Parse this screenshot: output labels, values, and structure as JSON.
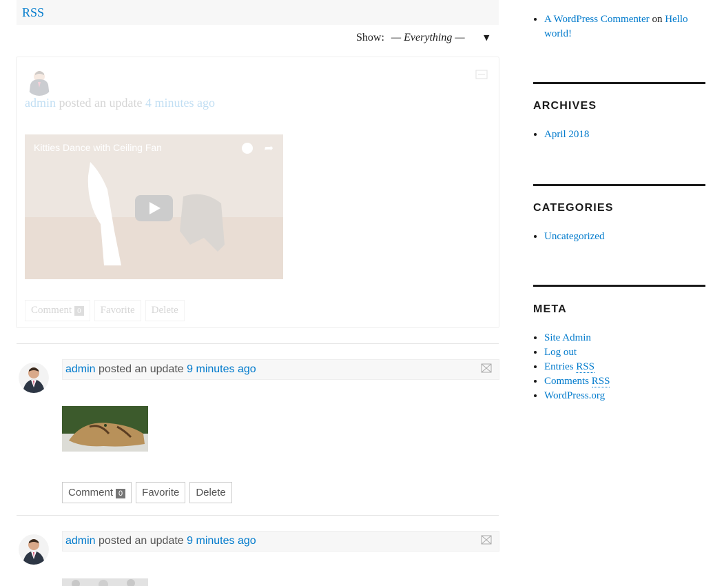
{
  "header": {
    "rss_label": "RSS"
  },
  "filter": {
    "show_label": "Show:",
    "selected": "— Everything —",
    "arrow": "▼"
  },
  "faded_update": {
    "user": "admin",
    "action": "posted an update",
    "time": "4 minutes ago",
    "video_title": "Kitties Dance with Ceiling Fan",
    "buttons": {
      "comment": "Comment",
      "comment_count": "0",
      "favorite": "Favorite",
      "delete": "Delete"
    }
  },
  "updates": [
    {
      "user": "admin",
      "action": "posted an update",
      "time": "9 minutes ago",
      "buttons": {
        "comment": "Comment",
        "comment_count": "0",
        "favorite": "Favorite",
        "delete": "Delete"
      }
    },
    {
      "user": "admin",
      "action": "posted an update",
      "time": "9 minutes ago"
    }
  ],
  "sidebar": {
    "recent_comment": {
      "author": "A WordPress Commenter",
      "on": "on",
      "post": "Hello world!"
    },
    "archives": {
      "title": "ARCHIVES",
      "items": [
        "April 2018"
      ]
    },
    "categories": {
      "title": "CATEGORIES",
      "items": [
        "Uncategorized"
      ]
    },
    "meta": {
      "title": "META",
      "items": {
        "site_admin": "Site Admin",
        "log_out": "Log out",
        "entries": "Entries",
        "entries_rss": "RSS",
        "comments": "Comments",
        "comments_rss": "RSS",
        "wordpress": "WordPress.org"
      }
    }
  },
  "colors": {
    "link": "#007acc",
    "text": "#1a1a1a",
    "panel": "#f7f7f7"
  }
}
